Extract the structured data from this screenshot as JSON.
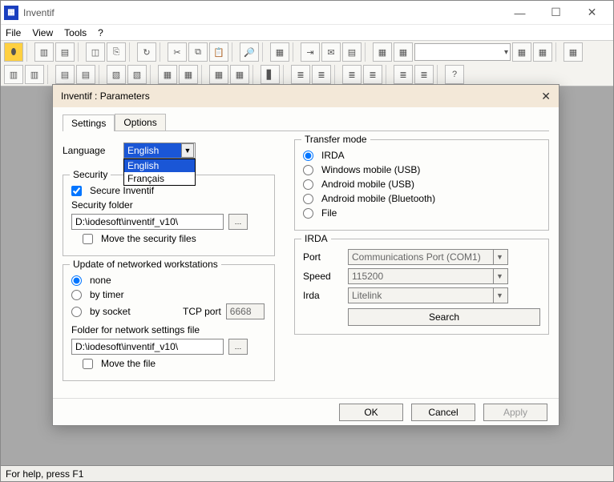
{
  "window": {
    "title": "Inventif",
    "menu": [
      "File",
      "View",
      "Tools",
      "?"
    ],
    "status": "For help, press F1"
  },
  "dialog": {
    "title": "Inventif : Parameters",
    "tabs": {
      "settings": "Settings",
      "options": "Options"
    },
    "language": {
      "label": "Language",
      "selected": "English",
      "options": [
        "English",
        "Français"
      ]
    },
    "security": {
      "legend": "Security",
      "secure_label": "Secure Inventif",
      "folder_label": "Security folder",
      "folder_value": "D:\\iodesoft\\inventif_v10\\",
      "move_label": "Move the security files"
    },
    "update": {
      "legend": "Update of networked workstations",
      "none_label": "none",
      "timer_label": "by timer",
      "socket_label": "by socket",
      "tcp_label": "TCP port",
      "tcp_value": "6668",
      "folder_label": "Folder for network settings file",
      "folder_value": "D:\\iodesoft\\inventif_v10\\",
      "move_label": "Move the file"
    },
    "transfer": {
      "legend": "Transfer mode",
      "irda": "IRDA",
      "winmob": "Windows mobile (USB)",
      "andusb": "Android mobile (USB)",
      "andbt": "Android mobile (Bluetooth)",
      "file": "File"
    },
    "irda": {
      "legend": "IRDA",
      "port_label": "Port",
      "port_value": "Communications Port (COM1)",
      "speed_label": "Speed",
      "speed_value": "115200",
      "irda_label": "Irda",
      "irda_value": "Litelink",
      "search_label": "Search"
    },
    "buttons": {
      "ok": "OK",
      "cancel": "Cancel",
      "apply": "Apply"
    }
  }
}
